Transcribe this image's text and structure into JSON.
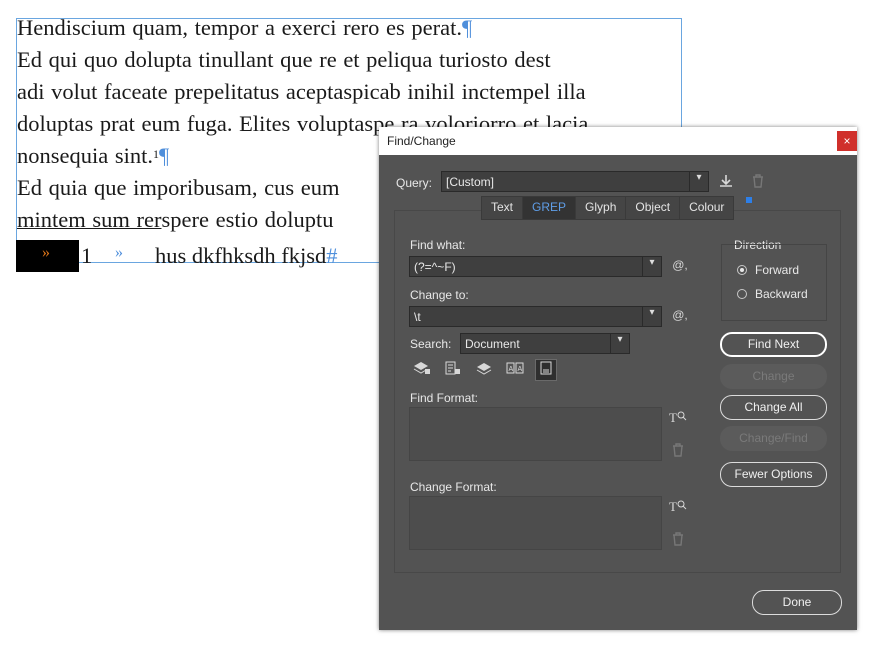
{
  "document": {
    "line1": "Hendiscium quam, tempor a exerci rero es perat.",
    "line2": "Ed qui quo dolupta tinullant que re et peliqua turiosto dest",
    "line3": "adi volut faceate prepelitatus aceptaspicab inihil inctempel illa",
    "line4": "doluptas prat eum fuga. Elites voluptaspe ra voloriorro et lacia",
    "line5": "nonsequia sint.",
    "line5_sup": "1",
    "line6": "Ed quia que imporibusam, cus eum",
    "line7_underlined": "mintem sum rer",
    "line7_rest": "spere estio doluptu",
    "line8_arrow1": "»",
    "line8_num": "1",
    "line8_arrow2": "»",
    "line8_text": "hus dkfhksdh fkjsd",
    "pilcrow": "¶",
    "end_mark": "#"
  },
  "dialog": {
    "title": "Find/Change",
    "close_label": "×",
    "query_label": "Query:",
    "query_value": "[Custom]",
    "tabs": [
      "Text",
      "GREP",
      "Glyph",
      "Object",
      "Colour"
    ],
    "active_tab": "GREP",
    "find_what_label": "Find what:",
    "find_what_value": "(?=^~F)",
    "change_to_label": "Change to:",
    "change_to_value": "\\t",
    "search_label": "Search:",
    "search_value": "Document",
    "find_format_label": "Find Format:",
    "change_format_label": "Change Format:",
    "direction_label": "Direction",
    "forward_label": "Forward",
    "backward_label": "Backward",
    "direction_selected": "Forward",
    "buttons": {
      "find_next": "Find Next",
      "change": "Change",
      "change_all": "Change All",
      "change_find": "Change/Find",
      "fewer_options": "Fewer Options",
      "done": "Done"
    },
    "icons": {
      "dropdown": "▾",
      "special_char": "@,",
      "format_icon": "T",
      "trash": "🗑"
    }
  }
}
